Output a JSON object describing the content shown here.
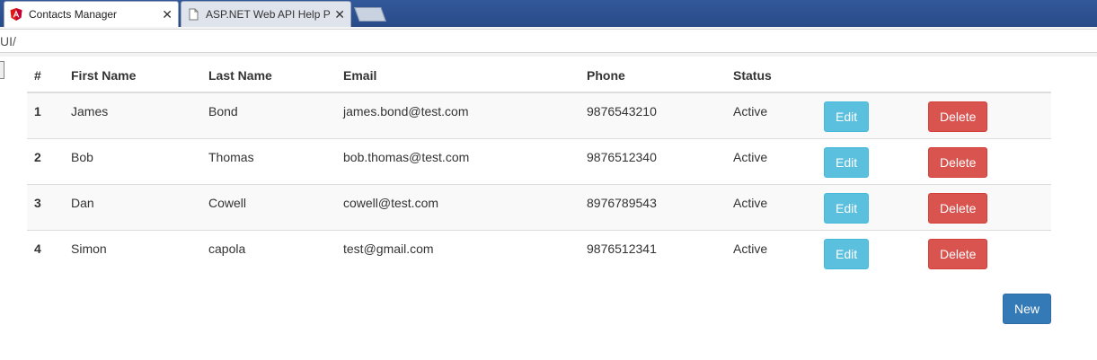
{
  "browser": {
    "tabs": [
      {
        "title": "Contacts Manager",
        "favicon": "angular-icon",
        "active": true
      },
      {
        "title": "ASP.NET Web API Help P",
        "favicon": "page-icon",
        "active": false
      }
    ],
    "close_glyph": "✕",
    "address": "UI/"
  },
  "table": {
    "headers": [
      "#",
      "First Name",
      "Last Name",
      "Email",
      "Phone",
      "Status"
    ],
    "rows": [
      {
        "num": "1",
        "first": "James",
        "last": "Bond",
        "email": "james.bond@test.com",
        "phone": "9876543210",
        "status": "Active"
      },
      {
        "num": "2",
        "first": "Bob",
        "last": "Thomas",
        "email": "bob.thomas@test.com",
        "phone": "9876512340",
        "status": "Active"
      },
      {
        "num": "3",
        "first": "Dan",
        "last": "Cowell",
        "email": "cowell@test.com",
        "phone": "8976789543",
        "status": "Active"
      },
      {
        "num": "4",
        "first": "Simon",
        "last": "capola",
        "email": "test@gmail.com",
        "phone": "9876512341",
        "status": "Active"
      }
    ],
    "edit_label": "Edit",
    "delete_label": "Delete"
  },
  "actions": {
    "new_label": "New"
  },
  "colors": {
    "edit": "#5bc0de",
    "delete": "#d9534f",
    "new": "#337ab7",
    "tabstrip": "#2b4f8e",
    "angular": "#dd1b16"
  }
}
